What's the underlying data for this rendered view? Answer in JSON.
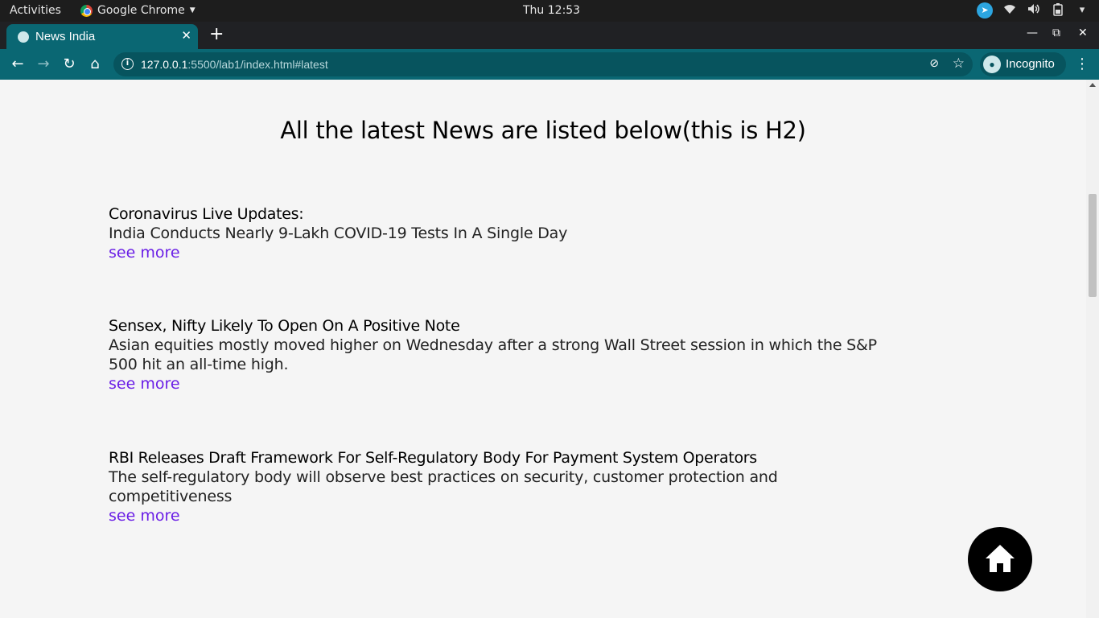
{
  "system_bar": {
    "activities": "Activities",
    "app_name": "Google Chrome",
    "clock": "Thu 12:53"
  },
  "browser": {
    "tab_title": "News India",
    "url_host": "127.0.0.1",
    "url_path": ":5500/lab1/index.html#latest",
    "profile_label": "Incognito"
  },
  "page": {
    "heading": "All the latest News are listed below(this is H2)",
    "articles": [
      {
        "headline": "Coronavirus Live Updates:",
        "summary": "India Conducts Nearly 9-Lakh COVID-19 Tests In A Single Day",
        "link": "see more"
      },
      {
        "headline": "Sensex, Nifty Likely To Open On A Positive Note",
        "summary": "Asian equities mostly moved higher on Wednesday after a strong Wall Street session in which the S&P 500 hit an all-time high.",
        "link": "see more"
      },
      {
        "headline": "RBI Releases Draft Framework For Self-Regulatory Body For Payment System Operators",
        "summary": "The self-regulatory body will observe best practices on security, customer protection and competitiveness",
        "link": "see more"
      }
    ],
    "fab_icon": "home-icon"
  },
  "colors": {
    "chrome_theme": "#0a6773",
    "link": "#6a1ee6",
    "fab": "#000000"
  }
}
